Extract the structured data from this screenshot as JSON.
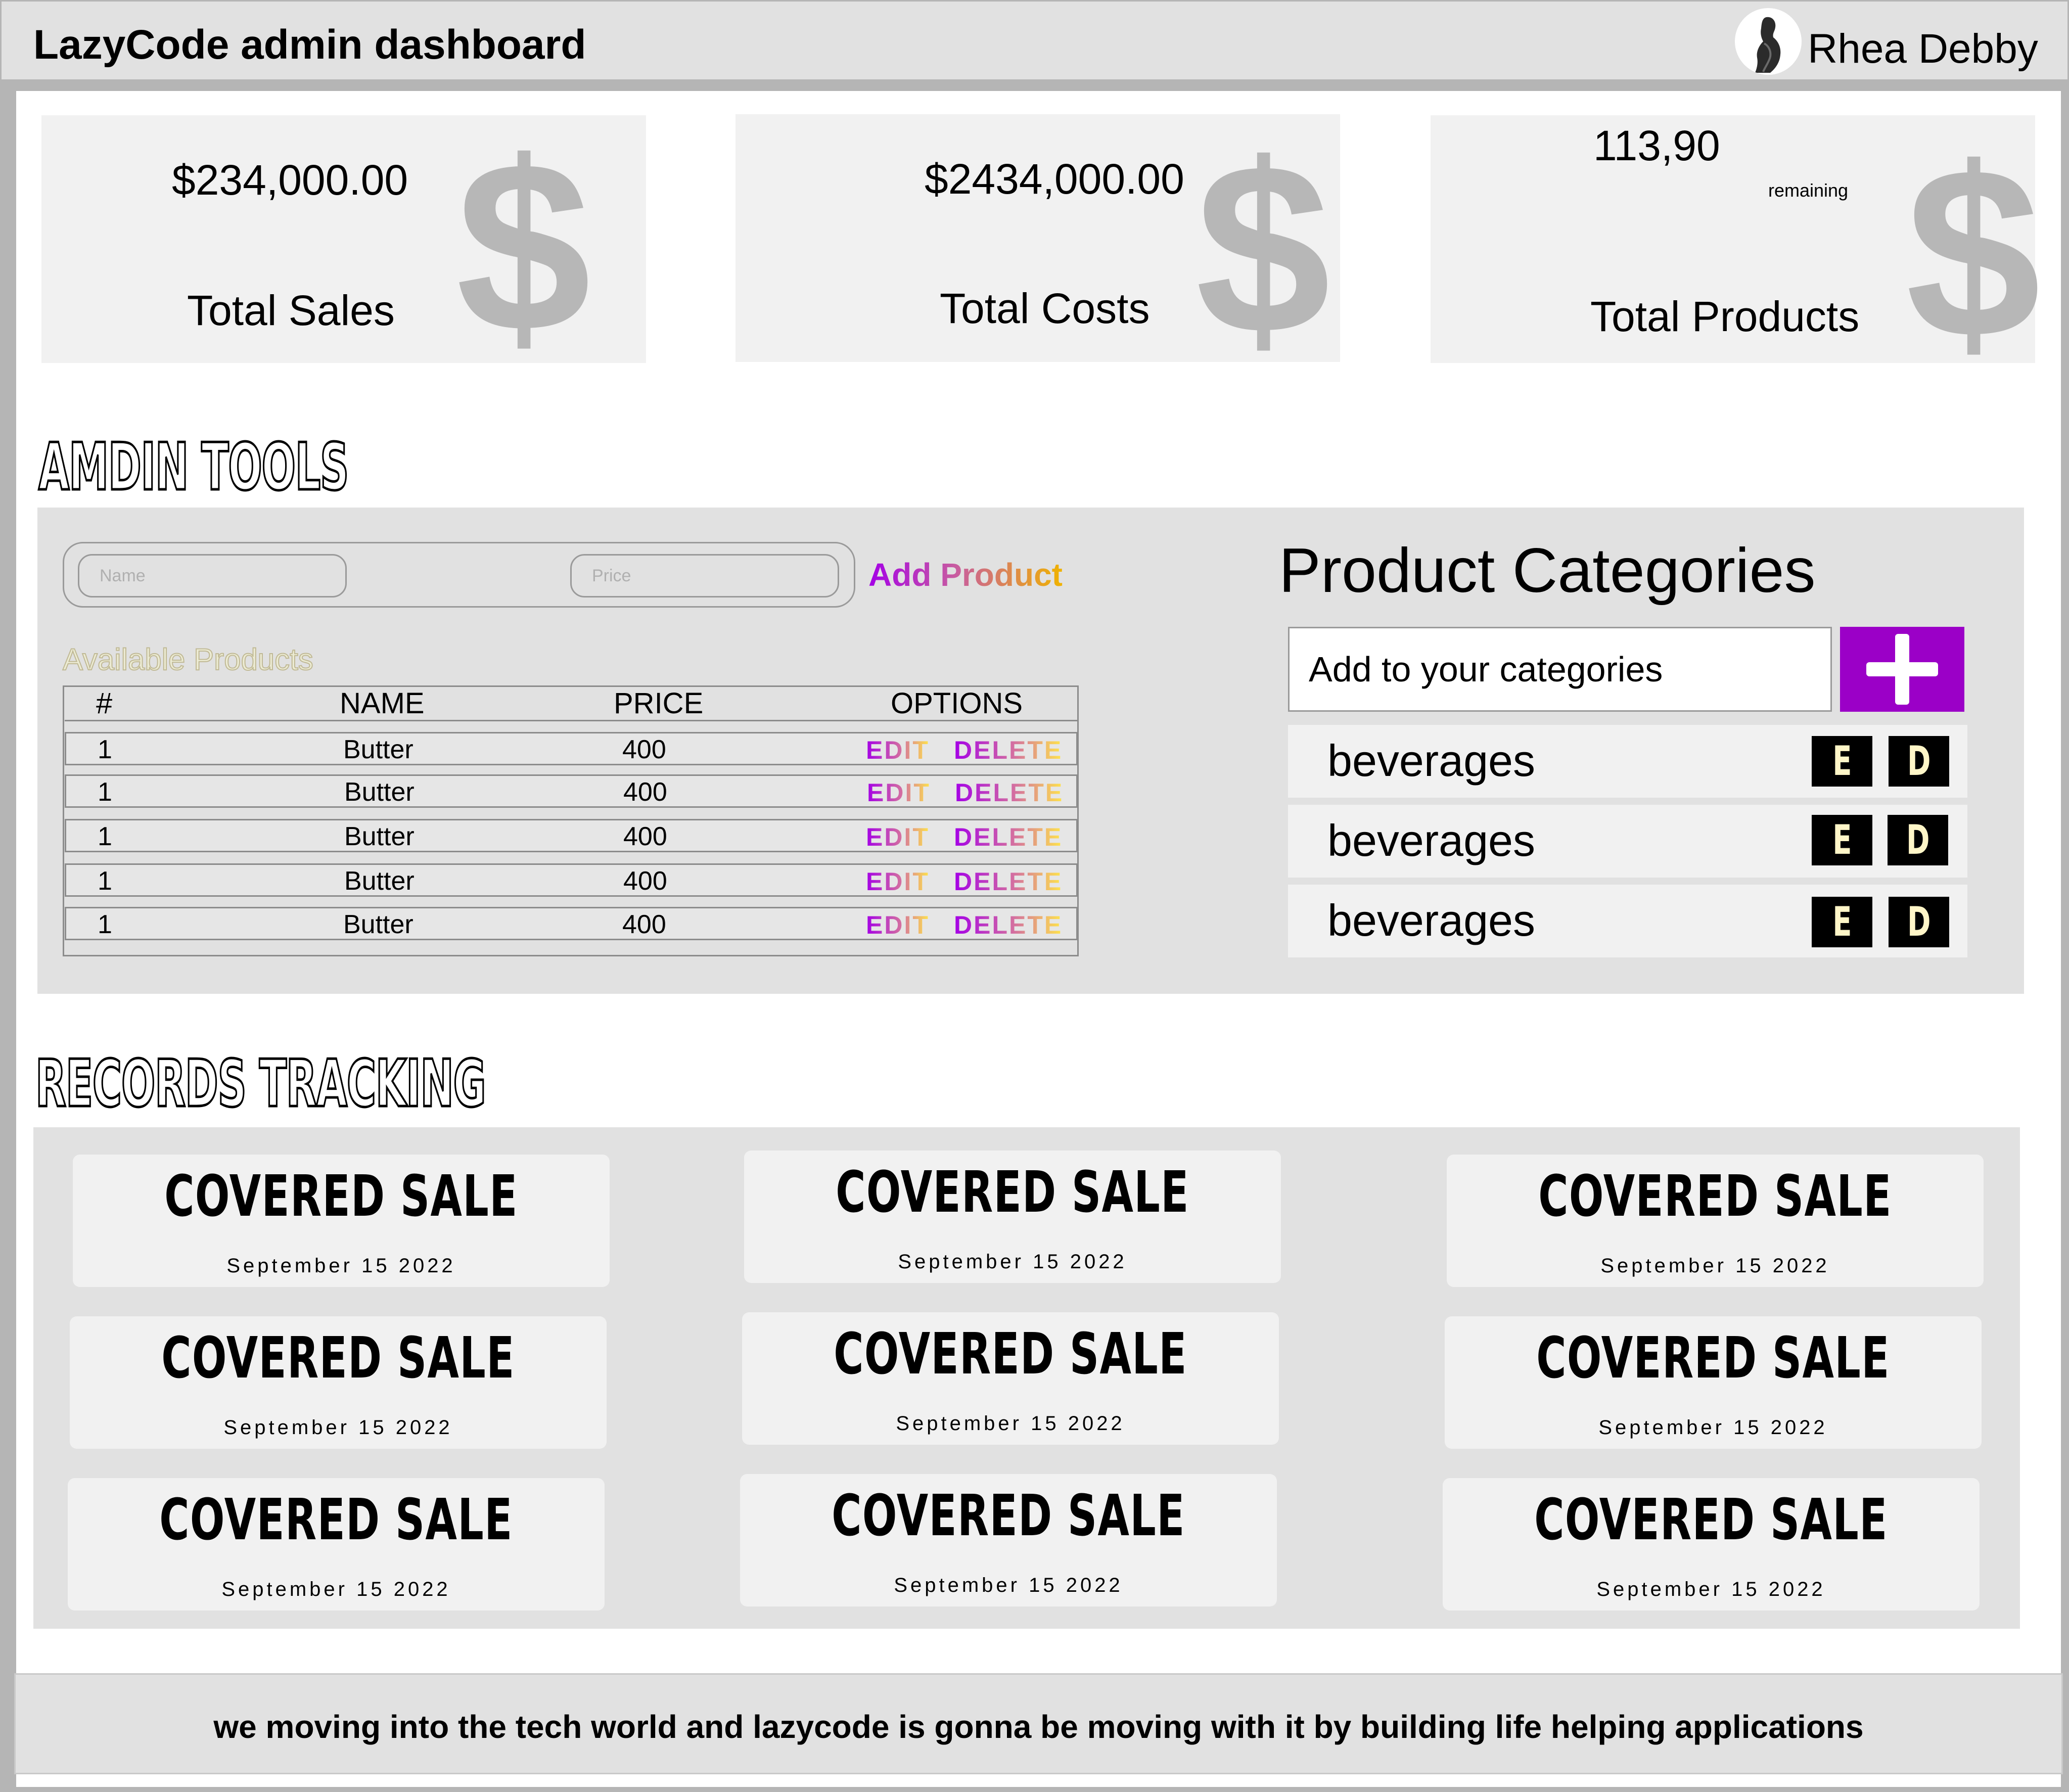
{
  "header": {
    "title": "LazyCode admin dashboard",
    "user_name": "Rhea Debby"
  },
  "stats": [
    {
      "value": "$234,000.00",
      "label": "Total Sales",
      "icon": "dollar-icon",
      "icon_glyph": "$"
    },
    {
      "value": "$2434,000.00",
      "label": "Total Costs",
      "icon": "dollar-icon",
      "icon_glyph": "$"
    },
    {
      "value": "113,90",
      "note": "remaining",
      "label": "Total Products",
      "icon": "dollar-icon",
      "icon_glyph": "$"
    }
  ],
  "admin_tools": {
    "heading": "AMDIN TOOLS",
    "form": {
      "name_placeholder": "Name",
      "price_placeholder": "Price",
      "add_label": "Add Product"
    },
    "available_label": "Available Products",
    "table": {
      "headers": [
        "#",
        "NAME",
        "PRICE",
        "OPTIONS"
      ],
      "rows": [
        {
          "id": "1",
          "name": "Butter",
          "price": "400"
        },
        {
          "id": "1",
          "name": "Butter",
          "price": "400"
        },
        {
          "id": "1",
          "name": "Butter",
          "price": "400"
        },
        {
          "id": "1",
          "name": "Butter",
          "price": "400"
        },
        {
          "id": "1",
          "name": "Butter",
          "price": "400"
        }
      ],
      "edit_label": "EDIT",
      "delete_label": "DELETE"
    },
    "categories": {
      "title": "Product Categories",
      "input_placeholder": "Add to your categories",
      "add_button_icon": "plus-icon",
      "items": [
        "beverages",
        "beverages",
        "beverages"
      ],
      "edit_label": "E",
      "delete_label": "D"
    }
  },
  "records": {
    "heading": "RECORDS TRACKING",
    "cards": [
      {
        "title": "COVERED SALE",
        "date": "September 15 2022"
      },
      {
        "title": "COVERED SALE",
        "date": "September 15 2022"
      },
      {
        "title": "COVERED SALE",
        "date": "September 15 2022"
      },
      {
        "title": "COVERED SALE",
        "date": "September 15 2022"
      },
      {
        "title": "COVERED SALE",
        "date": "September 15 2022"
      },
      {
        "title": "COVERED SALE",
        "date": "September 15 2022"
      },
      {
        "title": "COVERED SALE",
        "date": "September 15 2022"
      },
      {
        "title": "COVERED SALE",
        "date": "September 15 2022"
      },
      {
        "title": "COVERED SALE",
        "date": "September 15 2022"
      }
    ]
  },
  "footer": {
    "text": "we moving into the tech world and lazycode is gonna be moving with it by building life helping applications"
  },
  "colors": {
    "accent_purple": "#9b00c7",
    "panel_gray": "#e1e1e1",
    "card_gray": "#f1f1f1",
    "icon_gray": "#b7b7b7"
  }
}
